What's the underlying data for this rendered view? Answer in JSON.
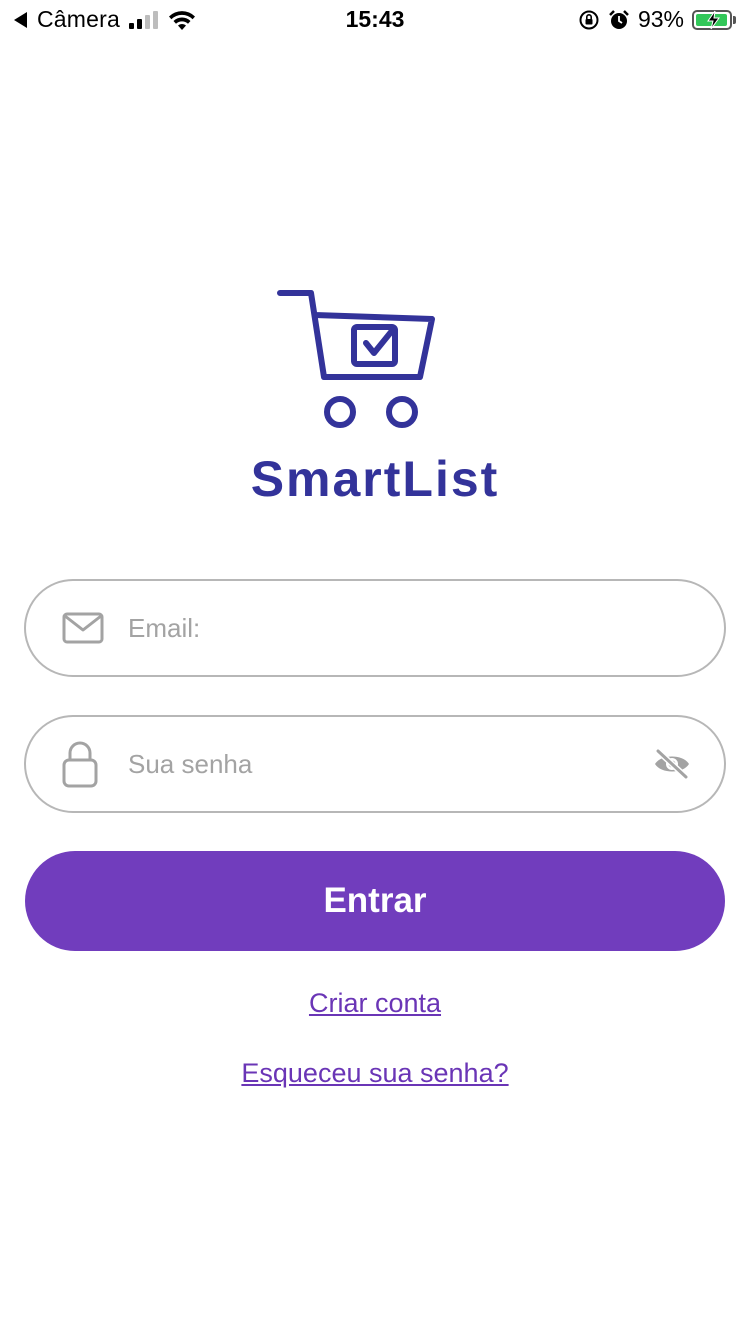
{
  "status_bar": {
    "back_label": "Câmera",
    "time": "15:43",
    "battery": "93%"
  },
  "brand": {
    "name": "SmartList",
    "color": "#33339a"
  },
  "login_form": {
    "email_placeholder": "Email:",
    "password_placeholder": "Sua senha",
    "submit_label": "Entrar",
    "create_account_label": "Criar conta",
    "forgot_password_label": "Esqueceu sua senha?"
  },
  "icons": {
    "email": "envelope-icon",
    "password": "lock-icon",
    "toggle_visibility": "eye-off-icon"
  },
  "colors": {
    "primary": "#713dbd",
    "link": "#6a35b6",
    "field_border": "#b7b7b7",
    "placeholder": "#a3a3a3"
  }
}
